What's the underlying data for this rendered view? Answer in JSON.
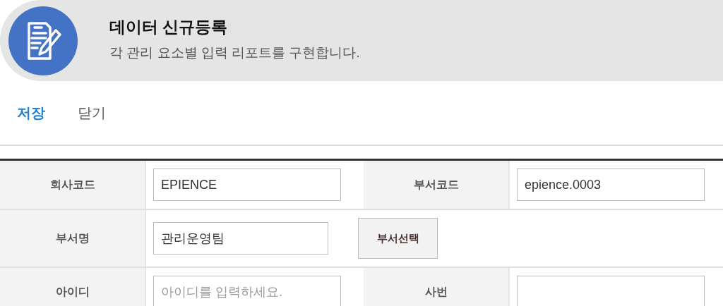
{
  "header": {
    "title": "데이터 신규등록",
    "subtitle": "각 관리 요소별 입력 리포트를 구현합니다."
  },
  "toolbar": [
    {
      "label": "저장",
      "kind": "primary"
    },
    {
      "label": "닫기",
      "kind": "plain"
    }
  ],
  "form": {
    "rows": [
      {
        "cells": [
          {
            "kind": "label",
            "text": "회사코드"
          },
          {
            "kind": "input",
            "value": "EPIENCE"
          },
          {
            "kind": "label",
            "text": "부서코드"
          },
          {
            "kind": "input",
            "value": "epience.0003"
          }
        ]
      },
      {
        "cells": [
          {
            "kind": "label",
            "text": "부서명"
          },
          {
            "kind": "input-button",
            "value": "관리운영팀",
            "button": "부서선택"
          }
        ]
      },
      {
        "cells": [
          {
            "kind": "label",
            "text": "아이디"
          },
          {
            "kind": "input",
            "placeholder": "아이디를 입력하세요."
          },
          {
            "kind": "label",
            "text": "사번"
          },
          {
            "kind": "input"
          }
        ]
      }
    ]
  }
}
